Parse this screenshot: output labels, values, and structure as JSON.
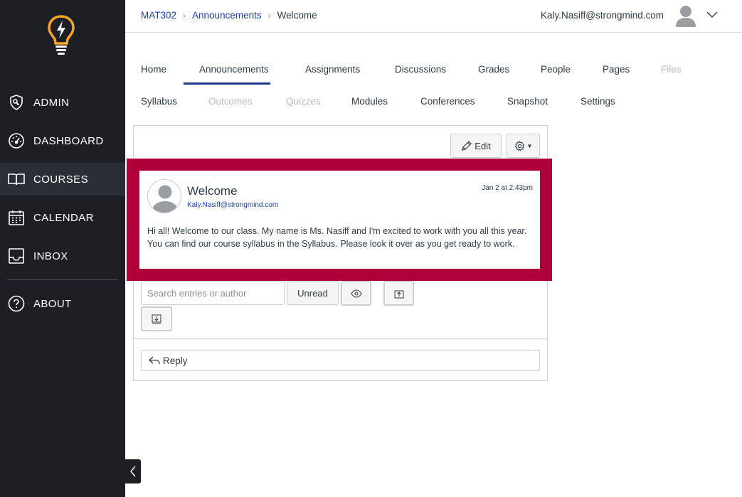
{
  "sidebar": {
    "items": [
      {
        "label": "ADMIN",
        "icon": "shield-icon"
      },
      {
        "label": "DASHBOARD",
        "icon": "gauge-icon"
      },
      {
        "label": "COURSES",
        "icon": "book-icon",
        "active": true
      },
      {
        "label": "CALENDAR",
        "icon": "calendar-icon"
      },
      {
        "label": "INBOX",
        "icon": "inbox-icon"
      },
      {
        "label": "ABOUT",
        "icon": "question-icon"
      }
    ],
    "logo_icon": "lightbulb-bolt-icon",
    "colors": {
      "background": "#1d1f24",
      "logo": "#f5a623"
    }
  },
  "header": {
    "breadcrumbs": [
      "MAT302",
      "Announcements",
      "Welcome"
    ],
    "user_email": "Kaly.Nasiff@strongmind.com"
  },
  "course_nav": {
    "row1": [
      {
        "label": "Home"
      },
      {
        "label": "Announcements",
        "active": true
      },
      {
        "label": "Assignments"
      },
      {
        "label": "Discussions"
      },
      {
        "label": "Grades"
      },
      {
        "label": "People"
      },
      {
        "label": "Pages"
      },
      {
        "label": "Files",
        "disabled": true
      }
    ],
    "row2": [
      {
        "label": "Syllabus"
      },
      {
        "label": "Outcomes",
        "disabled": true
      },
      {
        "label": "Quizzes",
        "disabled": true
      },
      {
        "label": "Modules"
      },
      {
        "label": "Conferences"
      },
      {
        "label": "Snapshot"
      },
      {
        "label": "Settings"
      }
    ]
  },
  "toolbar": {
    "edit_label": "Edit",
    "edit_icon": "pencil-icon",
    "settings_icon": "gear-icon"
  },
  "post": {
    "title": "Welcome",
    "author": "Kaly.Nasiff@strongmind.com",
    "date": "Jan 2 at 2:43pm",
    "body": "Hi all! Welcome to our class. My name is Ms. Nasiff and I'm excited to work with you all this year. You can find our course syllabus in the Syllabus. Please look it over as you get ready to work."
  },
  "filters": {
    "search_placeholder": "Search entries or author",
    "unread_label": "Unread"
  },
  "reply": {
    "label": "Reply"
  },
  "colors": {
    "highlight": "#b0003a",
    "link": "#1a3ea8",
    "active_tab_underline": "#1e3a8a"
  }
}
